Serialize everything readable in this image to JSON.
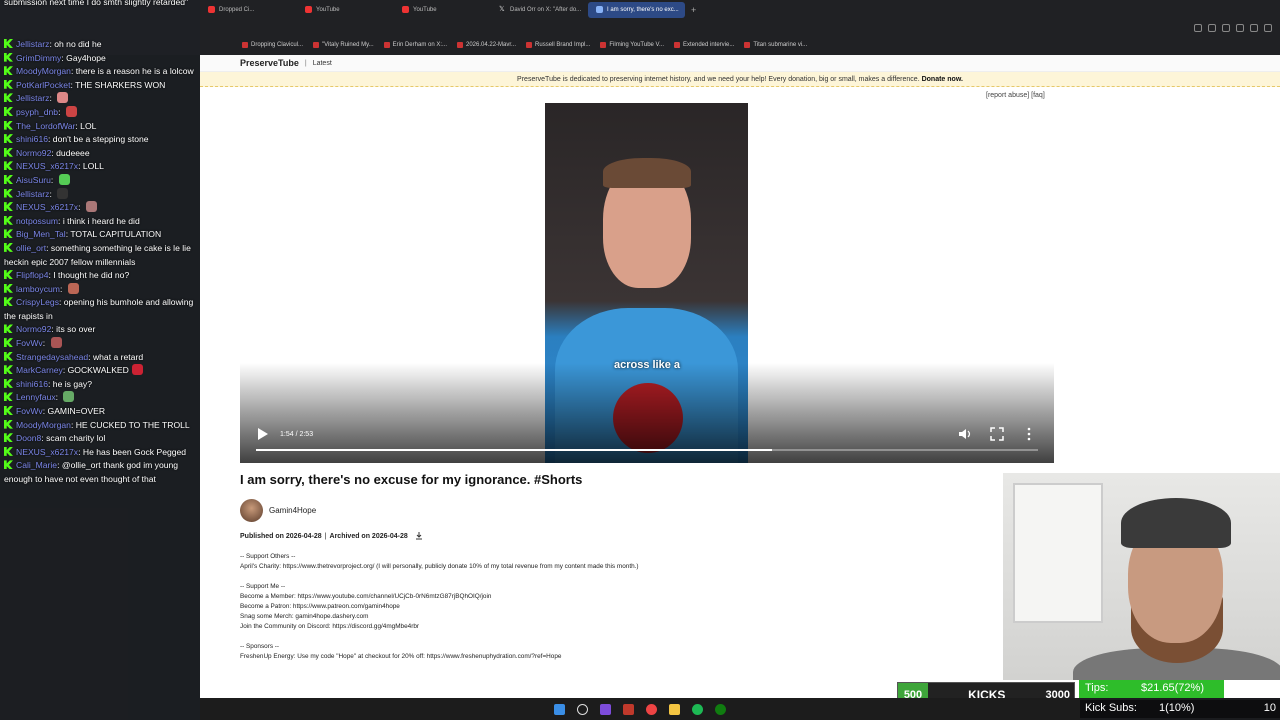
{
  "browser": {
    "tabs": [
      {
        "label": "Dropped Ci...",
        "icon": "youtube-icon"
      },
      {
        "label": "YouTube",
        "icon": "youtube-icon"
      },
      {
        "label": "YouTube",
        "icon": "youtube-icon"
      },
      {
        "label": "David Orr on X: \"After do...",
        "icon": "x-icon"
      },
      {
        "label": "I am sorry, there's no exc...",
        "icon": "preservetube-icon",
        "active": true
      }
    ],
    "new_tab": "+",
    "bookmarks": [
      "Dropping Clavicul...",
      "\"Vitaly Ruined My...",
      "Erin Derham on X:...",
      "2026.04.22-Mavr...",
      "Russell Brand Impl...",
      "Filming YouTube V...",
      "Extended intervie...",
      "Titan submarine vi..."
    ]
  },
  "site": {
    "logo": "PreserveTube",
    "separator": "|",
    "latest": "Latest",
    "banner_text": "PreserveTube is dedicated to preserving internet history, and we need your help! Every donation, big or small, makes a difference.",
    "banner_link": "Donate now.",
    "report_links": "[report abuse]  [faq]"
  },
  "video": {
    "caption": "across like a",
    "time": "1:54 / 2:53",
    "progress": 0.66,
    "title": "I am sorry, there's no excuse for my ignorance. #Shorts",
    "channel": "Gamin4Hope",
    "published_label": "Published on 2026-04-28",
    "archived_label": "Archived on 2026-04-28",
    "pub_sep": "|"
  },
  "description": [
    "-- Support Others --",
    "April's Charity: https://www.thetrevorproject.org/ (I will personally, publicly donate 10% of my total revenue from my content made this month.)",
    "",
    "-- Support Me --",
    "Become a Member: https://www.youtube.com/channel/UCjCb-0rN6mtzG87rjBQhOIQ/join",
    "Become a Patron: https://www.patreon.com/gamin4hope",
    "Snag some Merch: gamin4hope.dashery.com",
    "Join the Community on Discord: https://discord.gg/4mgMbe4rbr",
    "",
    "-- Sponsors --",
    "FreshenUp Energy: Use my code \"Hope\" at checkout for 20% off: https://www.freshenuphydration.com/?ref=Hope"
  ],
  "chat_top": "submission next time I do smth slightly retarded\"",
  "chat": [
    {
      "user": "Jellistarz",
      "text": "oh no did he"
    },
    {
      "user": "GrimDimmy",
      "text": "Gay4hope"
    },
    {
      "user": "MoodyMorgan",
      "text": "there is a reason he is a lolcow"
    },
    {
      "user": "PotKarlPocket",
      "text": "THE SHARKERS WON"
    },
    {
      "user": "Jellistarz",
      "text": "",
      "emote": "#d88"
    },
    {
      "user": "psyph_dnb",
      "text": "",
      "emote": "#c44"
    },
    {
      "user": "The_LordofWar",
      "text": "LOL"
    },
    {
      "user": "shini616",
      "text": "don't be a stepping stone"
    },
    {
      "user": "Normo92",
      "text": "dudeeee"
    },
    {
      "user": "NEXUS_x6217x",
      "text": "LOLL"
    },
    {
      "user": "AisuSuru",
      "text": "",
      "emote": "#5c5"
    },
    {
      "user": "Jellistarz",
      "text": "",
      "emote": "#333"
    },
    {
      "user": "NEXUS_x6217x",
      "text": "",
      "emote": "#a77"
    },
    {
      "user": "notpossum",
      "text": "i think i heard he did"
    },
    {
      "user": "Big_Men_Tal",
      "text": "TOTAL CAPITULATION"
    },
    {
      "user": "ollie_ort",
      "text": "something something le cake is le lie heckin epic 2007 fellow millennials"
    },
    {
      "user": "Flipflop4",
      "text": "I thought he did no?"
    },
    {
      "user": "lamboycum",
      "text": "",
      "emote": "#b65"
    },
    {
      "user": "CrispyLegs",
      "text": "opening his bumhole and allowing the rapists in"
    },
    {
      "user": "Normo92",
      "text": "its so over"
    },
    {
      "user": "FovWv",
      "text": "",
      "emote": "#a55"
    },
    {
      "user": "Strangedaysahead",
      "text": "what a retard"
    },
    {
      "user": "MarkCarney",
      "text": "GOCKWALKED",
      "emote": "#c23"
    },
    {
      "user": "shini616",
      "text": "he is gay?"
    },
    {
      "user": "Lennyfaux",
      "text": "",
      "emote": "#6a6"
    },
    {
      "user": "FovWv",
      "text": "GAMIN=OVER"
    },
    {
      "user": "MoodyMorgan",
      "text": "HE CUCKED TO THE TROLL"
    },
    {
      "user": "Doon8",
      "text": "scam charity lol"
    },
    {
      "user": "NEXUS_x6217x",
      "text": "He has been Gock Pegged"
    },
    {
      "user": "Cali_Marie",
      "text": "@ollie_ort thank god im young enough to have not even thought of that"
    }
  ],
  "kicks": {
    "low": "500",
    "label": "KICKS",
    "high": "3000"
  },
  "tips": {
    "label": "Tips:",
    "value": "$21.65(72%)",
    "goal": "$30",
    "fraction": 0.72
  },
  "subs": {
    "label": "Kick Subs:",
    "value": "1(10%)",
    "goal": "10"
  },
  "colors": {
    "kick_green": "#53fc18",
    "banner_bg": "#fdf5d8",
    "chat_user": "#7b86e8"
  }
}
